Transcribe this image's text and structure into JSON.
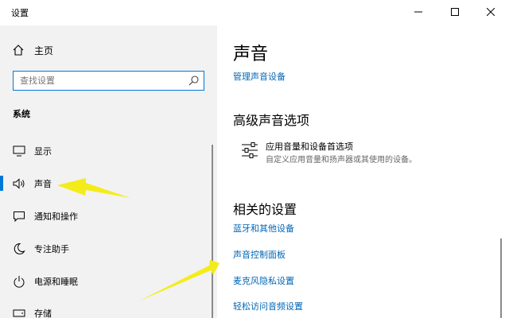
{
  "window": {
    "title": "设置"
  },
  "titlebar": {
    "minimize": "minimize-icon",
    "maximize": "maximize-icon",
    "close": "close-icon"
  },
  "sidebar": {
    "home_label": "主页",
    "search": {
      "placeholder": "查找设置",
      "value": ""
    },
    "section_title": "系统",
    "items": [
      {
        "label": "显示",
        "icon": "monitor-icon"
      },
      {
        "label": "声音",
        "icon": "speaker-icon",
        "selected": true
      },
      {
        "label": "通知和操作",
        "icon": "notification-icon"
      },
      {
        "label": "专注助手",
        "icon": "moon-icon"
      },
      {
        "label": "电源和睡眠",
        "icon": "power-icon"
      },
      {
        "label": "存储",
        "icon": "storage-icon"
      }
    ]
  },
  "main": {
    "title": "声音",
    "manage_link": "管理声音设备",
    "advanced_title": "高级声音选项",
    "app_option": {
      "title": "应用音量和设备首选项",
      "description": "自定义应用音量和扬声器或其使用的设备。",
      "icon": "sliders-icon"
    },
    "related_title": "相关的设置",
    "related_links": [
      "蓝牙和其他设备",
      "声音控制面板",
      "麦克风隐私设置",
      "轻松访问音频设置"
    ]
  },
  "colors": {
    "accent": "#0078d7",
    "link": "#0066b4",
    "sidebar_bg": "#f2f2f2",
    "annotation": "#f4ec1a"
  }
}
